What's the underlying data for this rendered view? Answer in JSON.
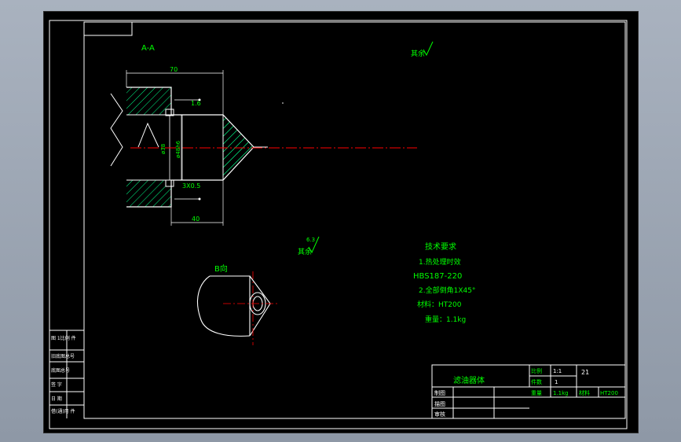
{
  "section_label": "A-A",
  "view_label": "B向",
  "dims": {
    "d70": "70",
    "d40": "40",
    "chamfer": "1.6",
    "groove": "3X0.5",
    "dia38": "ø38",
    "dia48": "ø48h6"
  },
  "roughness": {
    "top_mark": "其余",
    "mid_mark": "其余",
    "mid_value": "6.3"
  },
  "tech_requirements": {
    "title": "技术要求",
    "line1": "1.热处理时效",
    "line2": "HBS187-220",
    "line3": "2.全部倒角1X45°",
    "line4": "材料：HT200",
    "line5": "重量：1.1kg"
  },
  "title_block": {
    "part_name": "滤油器体",
    "scale_label": "比例",
    "scale_value": "1:1",
    "qty_label": "件数",
    "qty_value": "1",
    "drawing_no": "21",
    "weight_label": "重量",
    "weight_value": "1.1kg",
    "material_label": "材料",
    "material_value": "HT200",
    "drawn_label": "制图",
    "designed_label": "描图",
    "checked_label": "审核"
  },
  "side_strip": {
    "r1": "图 1比例 件",
    "r2": "旧底图总号",
    "r3": "底图总号",
    "r4": "签 字",
    "r5": "日 期",
    "r6": "借(通)用 件"
  }
}
